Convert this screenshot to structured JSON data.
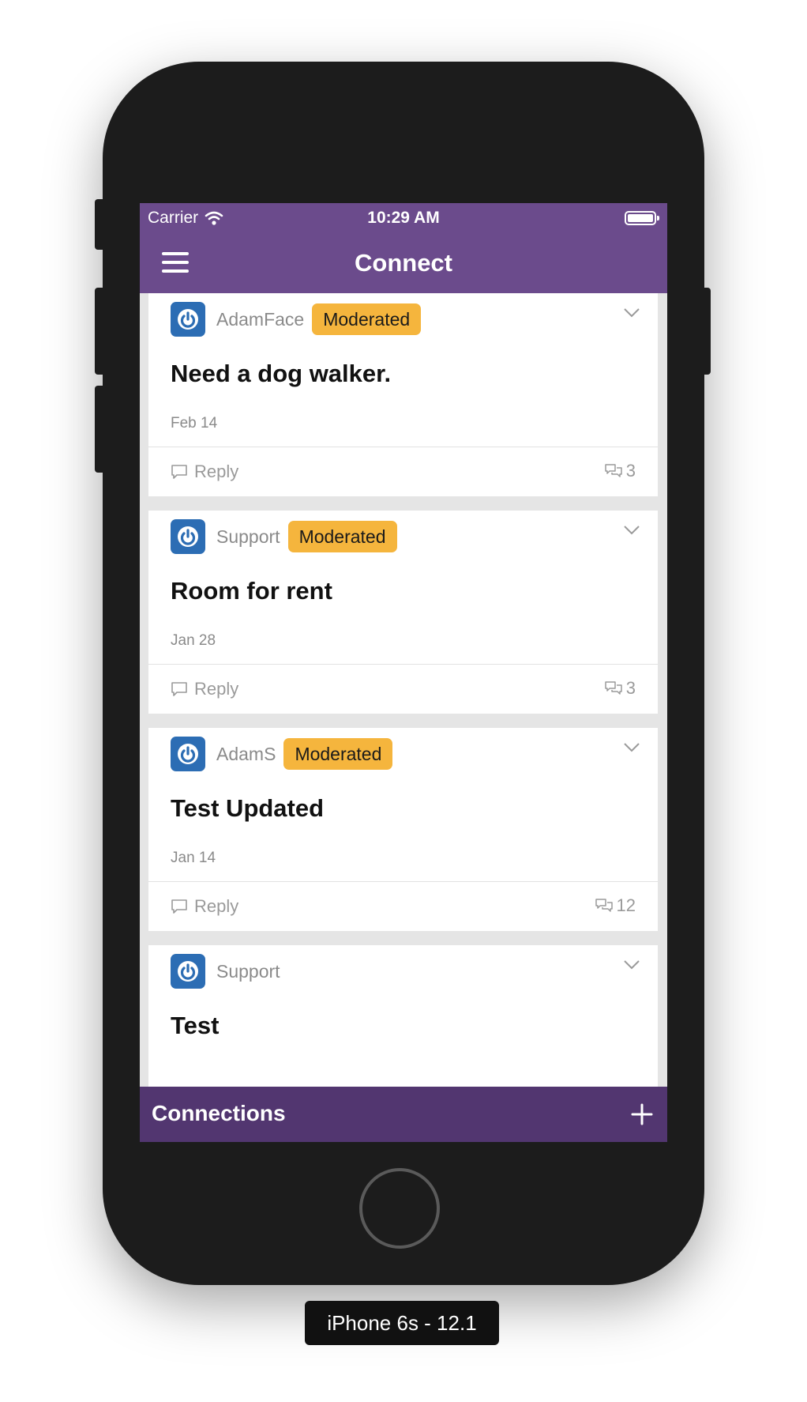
{
  "status_bar": {
    "carrier": "Carrier",
    "time": "10:29 AM"
  },
  "header": {
    "title": "Connect"
  },
  "posts": [
    {
      "author": "AdamFace",
      "badge": "Moderated",
      "title": "Need a dog walker.",
      "date": "Feb 14",
      "reply_label": "Reply",
      "comment_count": "3"
    },
    {
      "author": "Support",
      "badge": "Moderated",
      "title": "Room for rent",
      "date": "Jan 28",
      "reply_label": "Reply",
      "comment_count": "3"
    },
    {
      "author": "AdamS",
      "badge": "Moderated",
      "title": "Test Updated",
      "date": "Jan 14",
      "reply_label": "Reply",
      "comment_count": "12"
    },
    {
      "author": "Support",
      "title": "Test"
    }
  ],
  "bottom_bar": {
    "title": "Connections"
  },
  "device_label": "iPhone 6s - 12.1",
  "colors": {
    "header_purple": "#6b4b8c",
    "bottom_bar_purple": "#523670",
    "badge_orange": "#f5b53d",
    "avatar_blue": "#2c6db4"
  },
  "icons": {
    "menu": "hamburger-icon",
    "avatar": "power-icon",
    "expand": "chevron-down-icon",
    "reply": "speech-bubble-icon",
    "comments": "comments-icon",
    "add": "plus-icon",
    "wifi": "wifi-icon",
    "battery": "battery-icon"
  }
}
